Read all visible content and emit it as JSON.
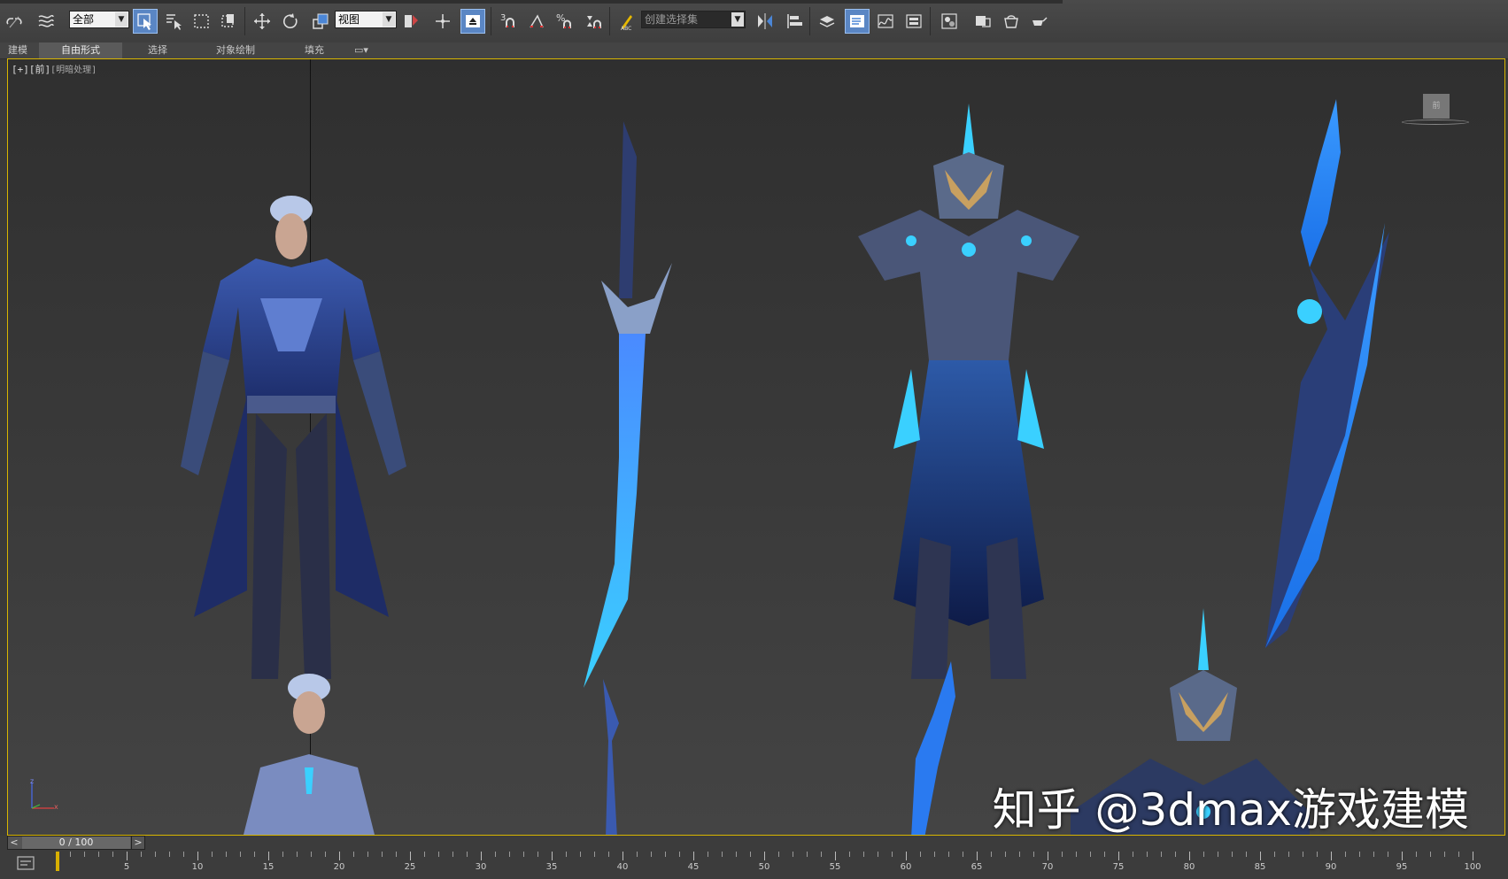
{
  "toolbar": {
    "selection_filter": "全部",
    "coord_system": "视图",
    "snap_angle": "3",
    "named_selection_placeholder": "创建选择集",
    "icons": [
      "undo-icon",
      "redo-icon",
      "link-icon",
      "unlink-icon",
      "bind-spacewarp-icon",
      "select-object-icon",
      "select-by-name-icon",
      "rect-region-icon",
      "window-crossing-icon",
      "move-icon",
      "rotate-icon",
      "scale-icon",
      "pivot-icon",
      "select-manipulate-icon",
      "snaps-toggle-icon",
      "angle-snap-icon",
      "percent-snap-icon",
      "spinner-snap-icon",
      "edit-named-sets-icon",
      "mirror-icon",
      "align-icon",
      "layer-explorer-icon",
      "scene-explorer-icon",
      "curve-editor-icon",
      "schematic-icon",
      "material-editor-icon",
      "render-setup-icon",
      "render-frame-icon",
      "render-icon"
    ]
  },
  "ribbon": {
    "tabs": [
      "建模",
      "自由形式",
      "选择",
      "对象绘制",
      "填充"
    ],
    "active": "自由形式"
  },
  "viewport": {
    "label": "[+][前]",
    "shading": "[明暗处理]",
    "viewcube_text": "前",
    "axis_z": "z",
    "axis_x": "x"
  },
  "watermark": "知乎 @3dmax游戏建模",
  "timeline": {
    "frame_display": "0 / 100",
    "prev": "<",
    "next": ">",
    "frame_labels": [
      "5",
      "10",
      "15",
      "20",
      "25",
      "30",
      "35",
      "40",
      "45",
      "50",
      "55",
      "60",
      "65",
      "70",
      "75",
      "80",
      "85",
      "90",
      "95",
      "100"
    ],
    "current_frame": 0,
    "total_frames": 100
  },
  "colors": {
    "accent": "#5a86c4",
    "viewport_border": "#d8b500",
    "armor_blue": "#2a4fa0",
    "glow_cyan": "#3ad0ff"
  }
}
